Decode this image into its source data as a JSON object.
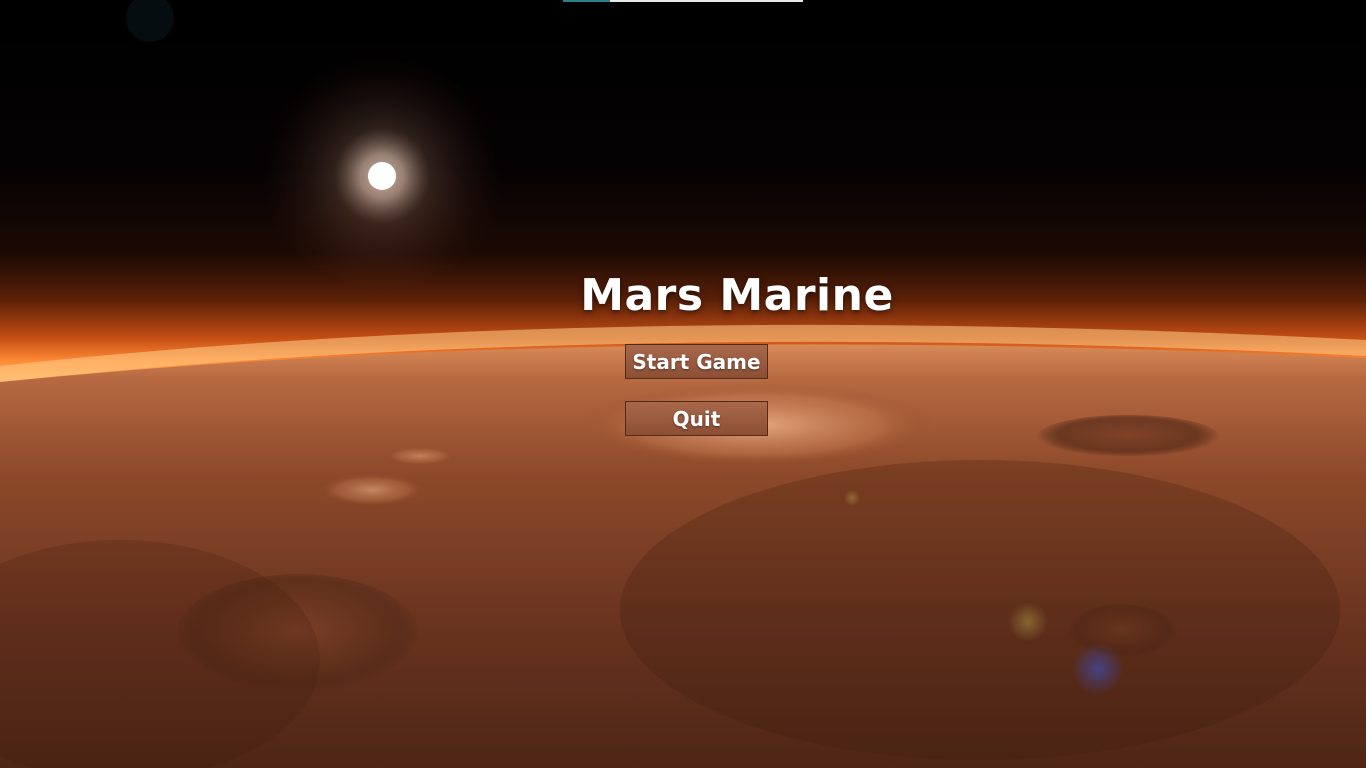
{
  "game": {
    "title": "Mars Marine"
  },
  "menu": {
    "start_label": "Start Game",
    "quit_label": "Quit"
  },
  "colors": {
    "space": "#000000",
    "horizon_glow": "#ff7a2a",
    "surface": "#7a3e22",
    "button_fill": "#9a5a3e",
    "title_text": "#ffffff"
  }
}
